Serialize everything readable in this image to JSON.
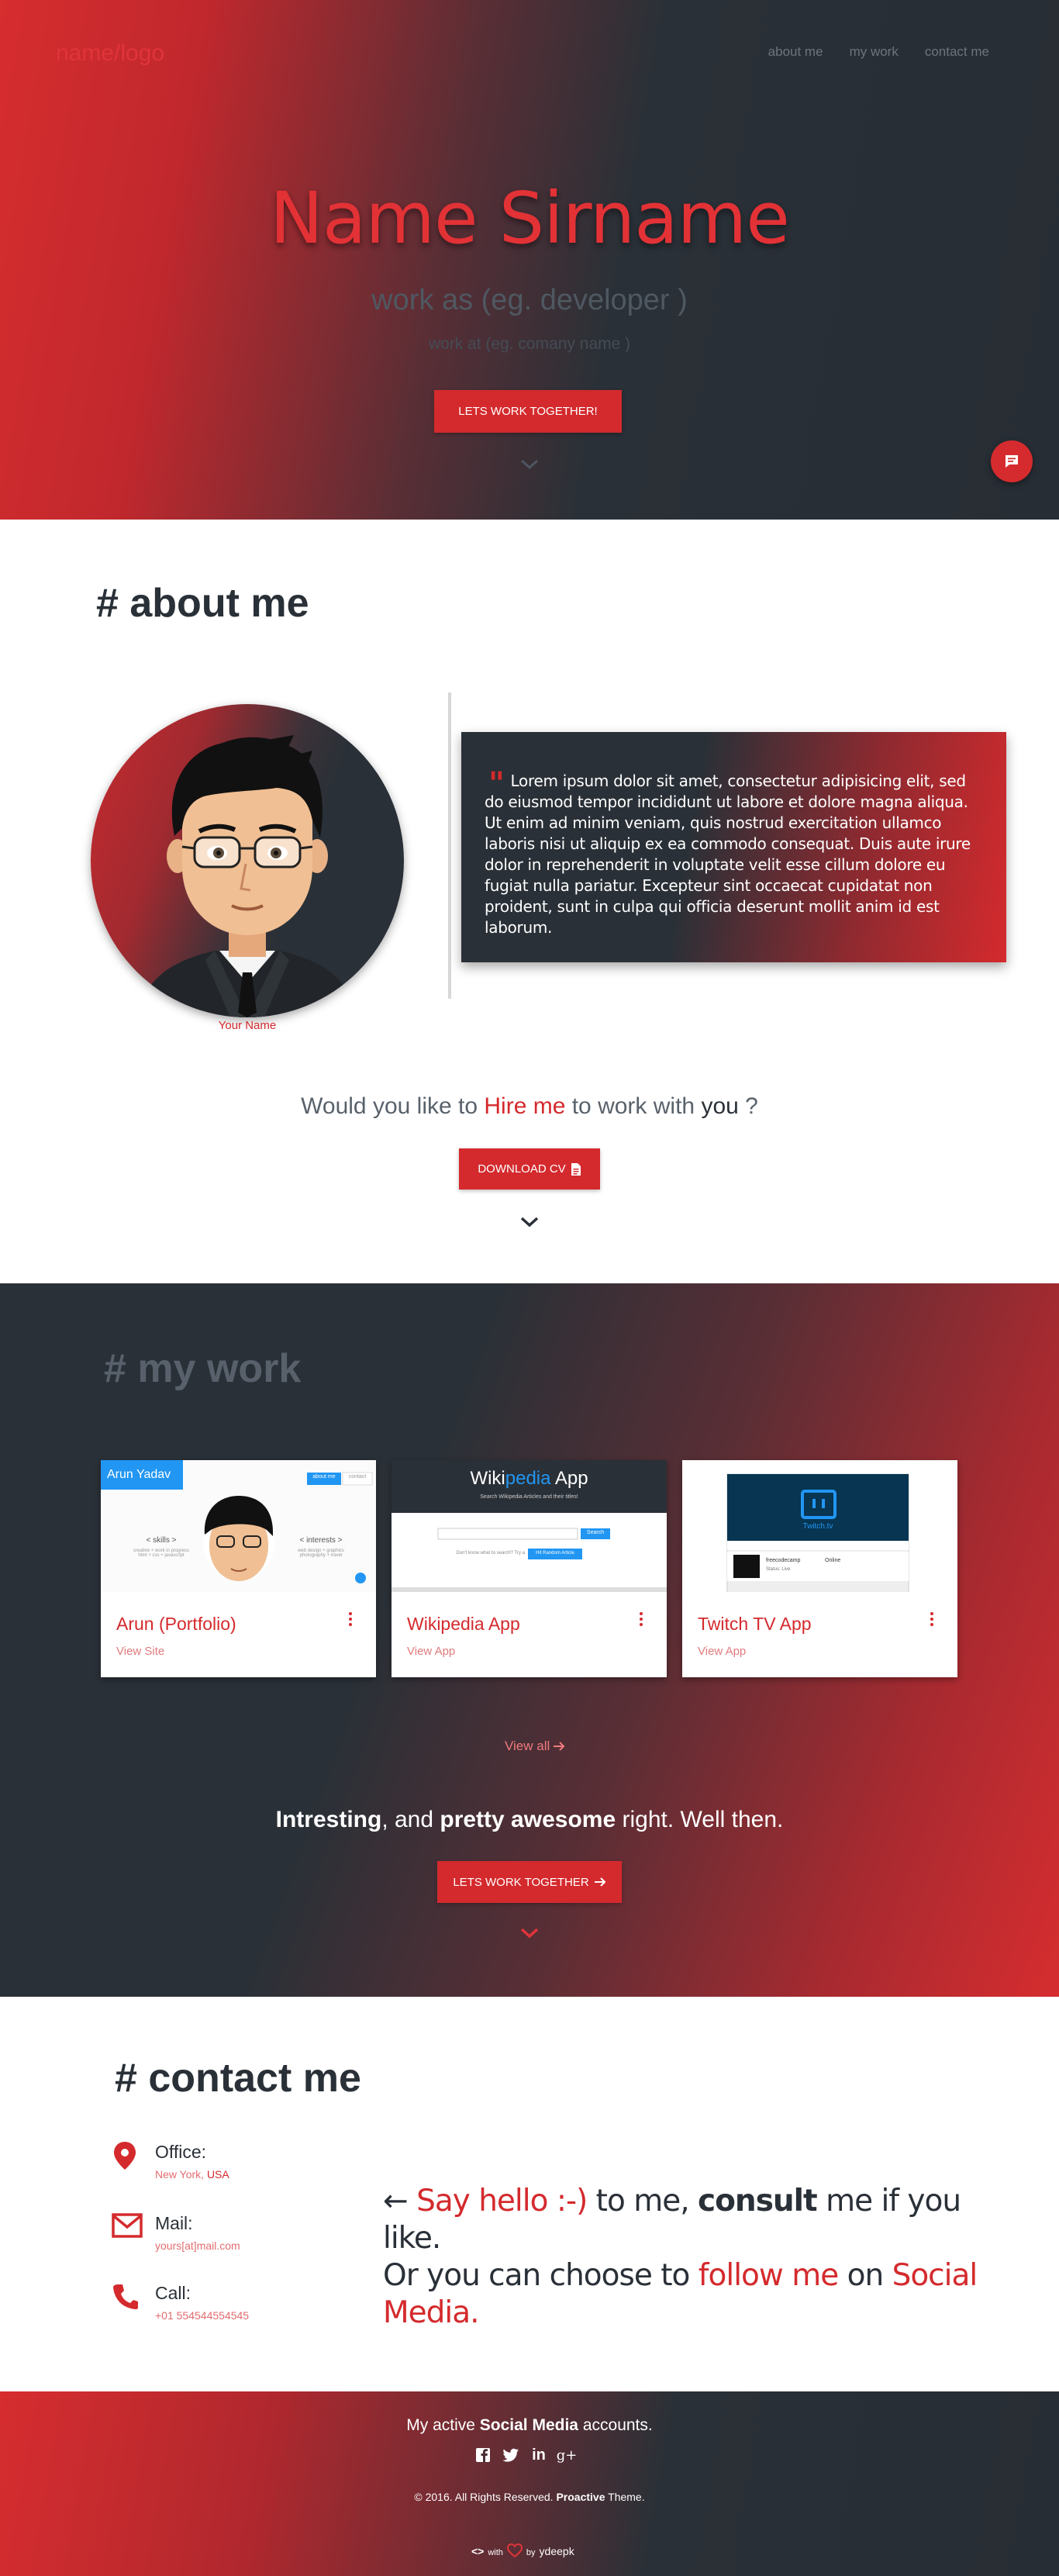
{
  "nav": {
    "logo": "name/logo",
    "links": [
      "about me",
      "my work",
      "contact me"
    ]
  },
  "hero": {
    "name": "Name Sirname",
    "work": "work as (eg. developer )",
    "company": "work at (eg. comany name )",
    "cta": "LETS WORK TOGETHER!"
  },
  "about": {
    "title": "# about me",
    "caption": "Your Name",
    "quote": "Lorem ipsum dolor sit amet, consectetur adipisicing elit, sed do eiusmod tempor incididunt ut labore et dolore magna aliqua. Ut enim ad minim veniam, quis nostrud exercitation ullamco laboris nisi ut aliquip ex ea commodo consequat. Duis aute irure dolor in reprehenderit in voluptate velit esse cillum dolore eu fugiat nulla pariatur. Excepteur sint occaecat cupidatat non proident, sunt in culpa qui officia deserunt mollit anim id est laborum.",
    "hire": {
      "p1": "Would you like to ",
      "p2": "Hire me",
      "p3": " to work with ",
      "p4": "you",
      "p5": " ?"
    },
    "cv_button": "DOWNLOAD CV"
  },
  "work": {
    "title_hash": "# ",
    "title_word": "my work",
    "cards": [
      {
        "title": "Arun (Portfolio)",
        "link": "View Site",
        "thumb": {
          "badge": "Arun Yadav",
          "nav1": "about me",
          "nav2": "contact",
          "left_head": "< skills >",
          "left_sub": "creative + work in progress\nhtml + css + javascript",
          "right_head": "< interests >",
          "right_sub": "web design + graphics\nphotography + travel"
        }
      },
      {
        "title": "Wikipedia App",
        "link": "View App",
        "thumb": {
          "name1": "Wiki",
          "name2": "pedia",
          "name3": " App",
          "tagline": "Search Wikipedia Articles and their titles!",
          "search_btn": "Search",
          "random_btn": "Hit Random Article",
          "random_label": "Don't know what to search? Try a"
        }
      },
      {
        "title": "Twitch TV App",
        "link": "View App",
        "thumb": {
          "brand": "Twitch.tv",
          "row_label": "Online",
          "row_name": "freecodecamp",
          "row_status": "Status: Live"
        }
      }
    ],
    "view_all": "View all",
    "tagline": {
      "p1": "Intresting",
      "p2": ", and ",
      "p3": "pretty awesome",
      "p4": " right. Well then."
    },
    "cta": "LETS WORK TOGETHER"
  },
  "contact": {
    "title": "# contact me",
    "items": [
      {
        "label": "Office:",
        "value_a": "New York, ",
        "value_b": "USA"
      },
      {
        "label": "Mail:",
        "value_a": "yours[at]mail.com",
        "value_b": ""
      },
      {
        "label": "Call:",
        "value_a": "+01 554544554545",
        "value_b": ""
      }
    ],
    "say": {
      "arrow": "← ",
      "p1": "Say hello :-)",
      "p2": " to me, ",
      "p3": "consult",
      "p4": " me if you like.",
      "p5": "Or you can choose to ",
      "p6": "follow me",
      "p7": " on ",
      "p8": "Social Media",
      "p9": "."
    }
  },
  "footer": {
    "social": {
      "p1": "My active ",
      "p2": "Social Media",
      "p3": " accounts."
    },
    "icons": [
      "f",
      "t",
      "in",
      "g+"
    ],
    "copy": {
      "p1": "© 2016. All Rights Reserved. ",
      "p2": "Proactive",
      "p3": " Theme."
    },
    "made": {
      "code": "<>",
      "with": "with",
      "by": "by",
      "author": "ydeepk"
    }
  },
  "colors": {
    "accent": "#d42a2d",
    "dark": "#2a3037"
  }
}
